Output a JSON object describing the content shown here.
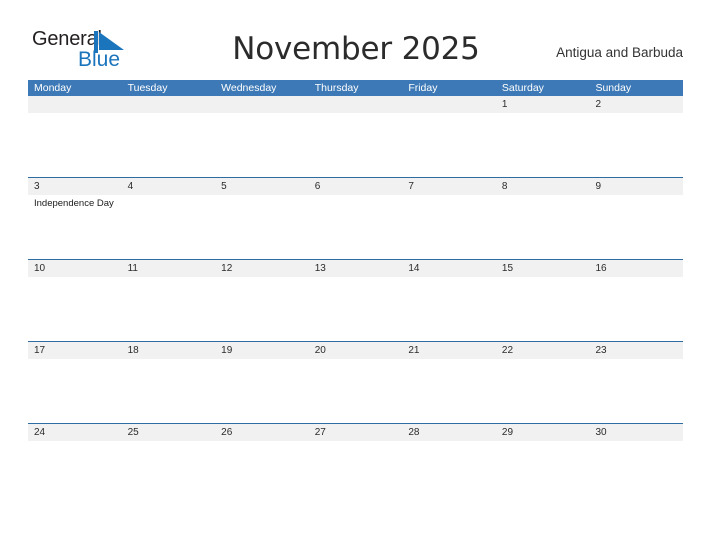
{
  "brand": {
    "name_part1": "General",
    "name_part2": "Blue",
    "logo_icon": "triangle-flag-icon",
    "color_primary": "#1b75bc",
    "color_text": "#231f20"
  },
  "header": {
    "title": "November 2025",
    "region": "Antigua and Barbuda"
  },
  "calendar": {
    "header_background": "#3d79b6",
    "date_band_background": "#f1f1f1",
    "separator_color": "#2e6da4",
    "weekdays": [
      "Monday",
      "Tuesday",
      "Wednesday",
      "Thursday",
      "Friday",
      "Saturday",
      "Sunday"
    ],
    "weeks": [
      {
        "days": [
          {
            "number": "",
            "events": []
          },
          {
            "number": "",
            "events": []
          },
          {
            "number": "",
            "events": []
          },
          {
            "number": "",
            "events": []
          },
          {
            "number": "",
            "events": []
          },
          {
            "number": "1",
            "events": []
          },
          {
            "number": "2",
            "events": []
          }
        ]
      },
      {
        "days": [
          {
            "number": "3",
            "events": [
              "Independence Day"
            ]
          },
          {
            "number": "4",
            "events": []
          },
          {
            "number": "5",
            "events": []
          },
          {
            "number": "6",
            "events": []
          },
          {
            "number": "7",
            "events": []
          },
          {
            "number": "8",
            "events": []
          },
          {
            "number": "9",
            "events": []
          }
        ]
      },
      {
        "days": [
          {
            "number": "10",
            "events": []
          },
          {
            "number": "11",
            "events": []
          },
          {
            "number": "12",
            "events": []
          },
          {
            "number": "13",
            "events": []
          },
          {
            "number": "14",
            "events": []
          },
          {
            "number": "15",
            "events": []
          },
          {
            "number": "16",
            "events": []
          }
        ]
      },
      {
        "days": [
          {
            "number": "17",
            "events": []
          },
          {
            "number": "18",
            "events": []
          },
          {
            "number": "19",
            "events": []
          },
          {
            "number": "20",
            "events": []
          },
          {
            "number": "21",
            "events": []
          },
          {
            "number": "22",
            "events": []
          },
          {
            "number": "23",
            "events": []
          }
        ]
      },
      {
        "days": [
          {
            "number": "24",
            "events": []
          },
          {
            "number": "25",
            "events": []
          },
          {
            "number": "26",
            "events": []
          },
          {
            "number": "27",
            "events": []
          },
          {
            "number": "28",
            "events": []
          },
          {
            "number": "29",
            "events": []
          },
          {
            "number": "30",
            "events": []
          }
        ]
      }
    ]
  }
}
